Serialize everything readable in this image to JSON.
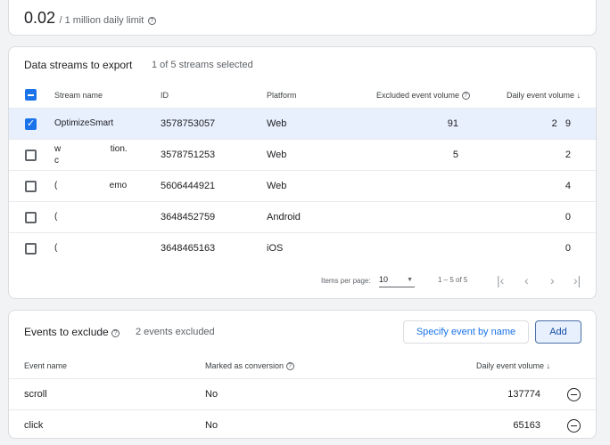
{
  "quota": {
    "value": "0.02",
    "limit": "/ 1 million daily limit"
  },
  "streams": {
    "title": "Data streams to export",
    "subtitle": "1 of 5 streams selected",
    "headers": {
      "name": "Stream name",
      "id": "ID",
      "platform": "Platform",
      "excluded": "Excluded event volume",
      "daily": "Daily event volume"
    },
    "rows": [
      {
        "name": "OptimizeSmart",
        "name2": "",
        "id": "3578753057",
        "platform": "Web",
        "excluded": "91",
        "daily": "2   9",
        "checked": true
      },
      {
        "name": "w                    tion.",
        "name2": "c",
        "id": "3578751253",
        "platform": "Web",
        "excluded": "5",
        "daily": "2",
        "checked": false
      },
      {
        "name": "(                     emo",
        "name2": "",
        "id": "5606444921",
        "platform": "Web",
        "excluded": "",
        "daily": "4",
        "checked": false
      },
      {
        "name": "(",
        "name2": "",
        "id": "3648452759",
        "platform": "Android",
        "excluded": "",
        "daily": "0",
        "checked": false
      },
      {
        "name": "(",
        "name2": "",
        "id": "3648465163",
        "platform": "iOS",
        "excluded": "",
        "daily": "0",
        "checked": false
      }
    ],
    "pagination": {
      "items_label": "Items per page:",
      "items_value": "10",
      "range": "1 – 5 of 5"
    }
  },
  "events": {
    "title": "Events to exclude",
    "subtitle": "2 events excluded",
    "specify_label": "Specify event by name",
    "add_label": "Add",
    "headers": {
      "name": "Event name",
      "conversion": "Marked as conversion",
      "daily": "Daily event volume"
    },
    "rows": [
      {
        "name": "scroll",
        "conversion": "No",
        "daily": "137774"
      },
      {
        "name": "click",
        "conversion": "No",
        "daily": "65163"
      }
    ]
  }
}
